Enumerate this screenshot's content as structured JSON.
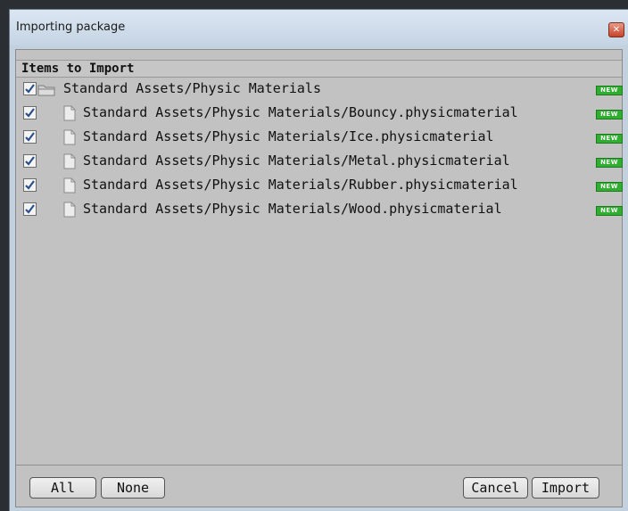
{
  "window": {
    "title": "Importing package"
  },
  "list": {
    "header": "Items to Import",
    "items": [
      {
        "label": "Standard Assets/Physic Materials",
        "type": "folder",
        "checked": true,
        "badge": "NEW"
      },
      {
        "label": "Standard Assets/Physic Materials/Bouncy.physicmaterial",
        "type": "file",
        "checked": true,
        "badge": "NEW"
      },
      {
        "label": "Standard Assets/Physic Materials/Ice.physicmaterial",
        "type": "file",
        "checked": true,
        "badge": "NEW"
      },
      {
        "label": "Standard Assets/Physic Materials/Metal.physicmaterial",
        "type": "file",
        "checked": true,
        "badge": "NEW"
      },
      {
        "label": "Standard Assets/Physic Materials/Rubber.physicmaterial",
        "type": "file",
        "checked": true,
        "badge": "NEW"
      },
      {
        "label": "Standard Assets/Physic Materials/Wood.physicmaterial",
        "type": "file",
        "checked": true,
        "badge": "NEW"
      }
    ]
  },
  "buttons": {
    "all": "All",
    "none": "None",
    "cancel": "Cancel",
    "import": "Import"
  },
  "icons": {
    "close": "close-icon",
    "folder": "folder-icon",
    "file": "file-icon",
    "checkbox": "checkbox-checked-icon"
  },
  "colors": {
    "badge": "#2fae2f",
    "panel": "#c2c2c2",
    "titlebar": "#c5d4e4"
  }
}
